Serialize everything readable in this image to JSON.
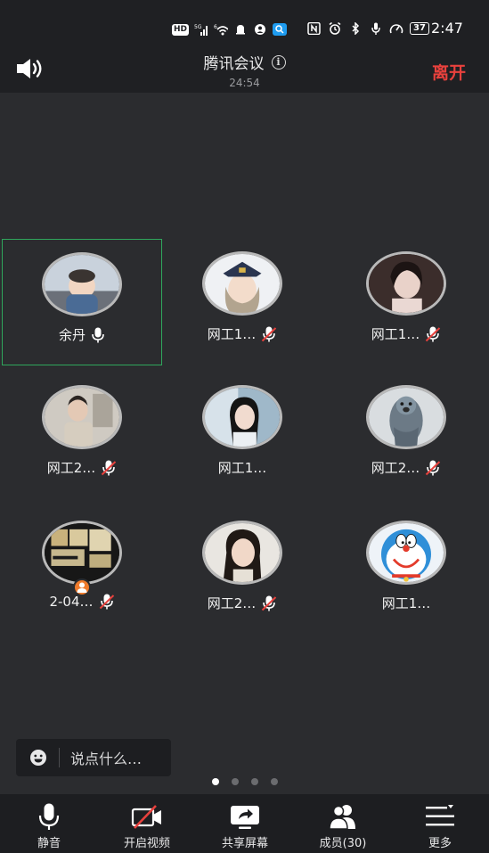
{
  "status_bar": {
    "network_badge": "HD",
    "signal_label": "5G",
    "wifi_label": "6",
    "battery": "37",
    "time": "2:47"
  },
  "header": {
    "title": "腾讯会议",
    "info_glyph": "i",
    "timer": "24:54",
    "leave_label": "离开"
  },
  "participants": [
    {
      "name": "余丹",
      "mic": "on",
      "active": true
    },
    {
      "name": "网工1…",
      "mic": "muted"
    },
    {
      "name": "网工1…",
      "mic": "muted"
    },
    {
      "name": "网工2…",
      "mic": "muted"
    },
    {
      "name": "网工1…",
      "mic": "none"
    },
    {
      "name": "网工2…",
      "mic": "muted"
    },
    {
      "name": "2-04…",
      "mic": "muted",
      "host": true
    },
    {
      "name": "网工2…",
      "mic": "muted"
    },
    {
      "name": "网工1…",
      "mic": "none"
    }
  ],
  "chat": {
    "placeholder": "说点什么…"
  },
  "pager": {
    "pages": 4,
    "current": 1
  },
  "toolbar": {
    "mute_label": "静音",
    "video_label": "开启视频",
    "share_label": "共享屏幕",
    "members_label": "成员(30)",
    "more_label": "更多"
  },
  "colors": {
    "background": "#2b2c2f",
    "bar": "#1f2023",
    "leave": "#e8413d",
    "active_border": "#2fa65c",
    "muted_slash": "#e8413d",
    "host_badge": "#f07b2b"
  }
}
